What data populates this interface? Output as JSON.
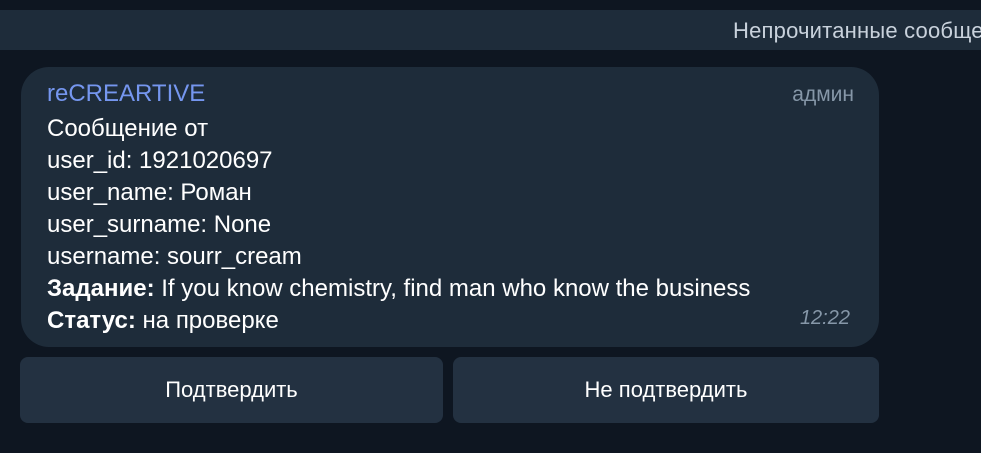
{
  "unread_bar": {
    "label": "Непрочитанные сообщения"
  },
  "message": {
    "sender": "reCREARTIVE",
    "role_badge": "админ",
    "lines": [
      "Сообщение от",
      "user_id: 1921020697",
      "user_name: Роман",
      "user_surname: None",
      "username: sourr_cream"
    ],
    "task": {
      "label": "Задание",
      "separator": ":",
      "value": " If you know chemistry, find man who know the business"
    },
    "status": {
      "label": "Статус:",
      "value": " на проверке"
    },
    "time": "12:22"
  },
  "inline_keyboard": {
    "confirm_label": "Подтвердить",
    "reject_label": "Не подтвердить"
  }
}
